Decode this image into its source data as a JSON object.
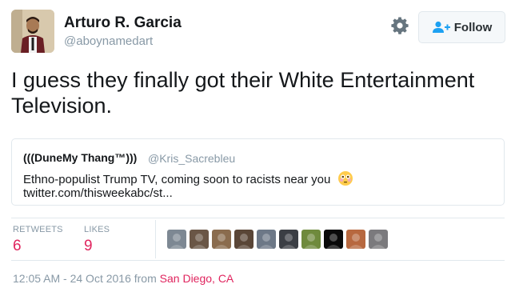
{
  "user": {
    "name": "Arturo R. Garcia",
    "handle": "@aboynamedart",
    "avatar_icon": "user-photo-avatar"
  },
  "actions": {
    "settings_icon": "gear-icon",
    "follow_icon": "add-person-icon",
    "follow_label": "Follow"
  },
  "tweet": {
    "text": "I guess they finally got their White Entertainment Television."
  },
  "quoted_tweet": {
    "name": "(((DuneMy Thang™)))",
    "handle": "@Kris_Sacrebleu",
    "text": "Ethno-populist Trump TV, coming soon to racists near you",
    "emoji_icon": "flushed-face-emoji",
    "link": "twitter.com/thisweekabc/st..."
  },
  "stats": {
    "retweets_label": "RETWEETS",
    "retweets_count": "6",
    "likes_label": "LIKES",
    "likes_count": "9"
  },
  "likers": [
    {
      "icon": "liker-avatar",
      "color": "#7d8893"
    },
    {
      "icon": "liker-avatar",
      "color": "#6a5646"
    },
    {
      "icon": "liker-avatar",
      "color": "#8a6c4e"
    },
    {
      "icon": "liker-avatar",
      "color": "#5a4637"
    },
    {
      "icon": "liker-avatar",
      "color": "#6d7887"
    },
    {
      "icon": "liker-avatar",
      "color": "#3b3e44"
    },
    {
      "icon": "liker-avatar",
      "color": "#6f8a3d"
    },
    {
      "icon": "liker-avatar",
      "color": "#0a0a0a"
    },
    {
      "icon": "liker-avatar",
      "color": "#b7683f"
    },
    {
      "icon": "liker-avatar",
      "color": "#7b7a7d"
    }
  ],
  "meta": {
    "timestamp": "12:05 AM - 24 Oct 2016 from ",
    "location": "San Diego, CA"
  },
  "colors": {
    "accent": "#e0245e",
    "secondary_text": "#8899a6",
    "link_blue": "#1da1f2"
  }
}
